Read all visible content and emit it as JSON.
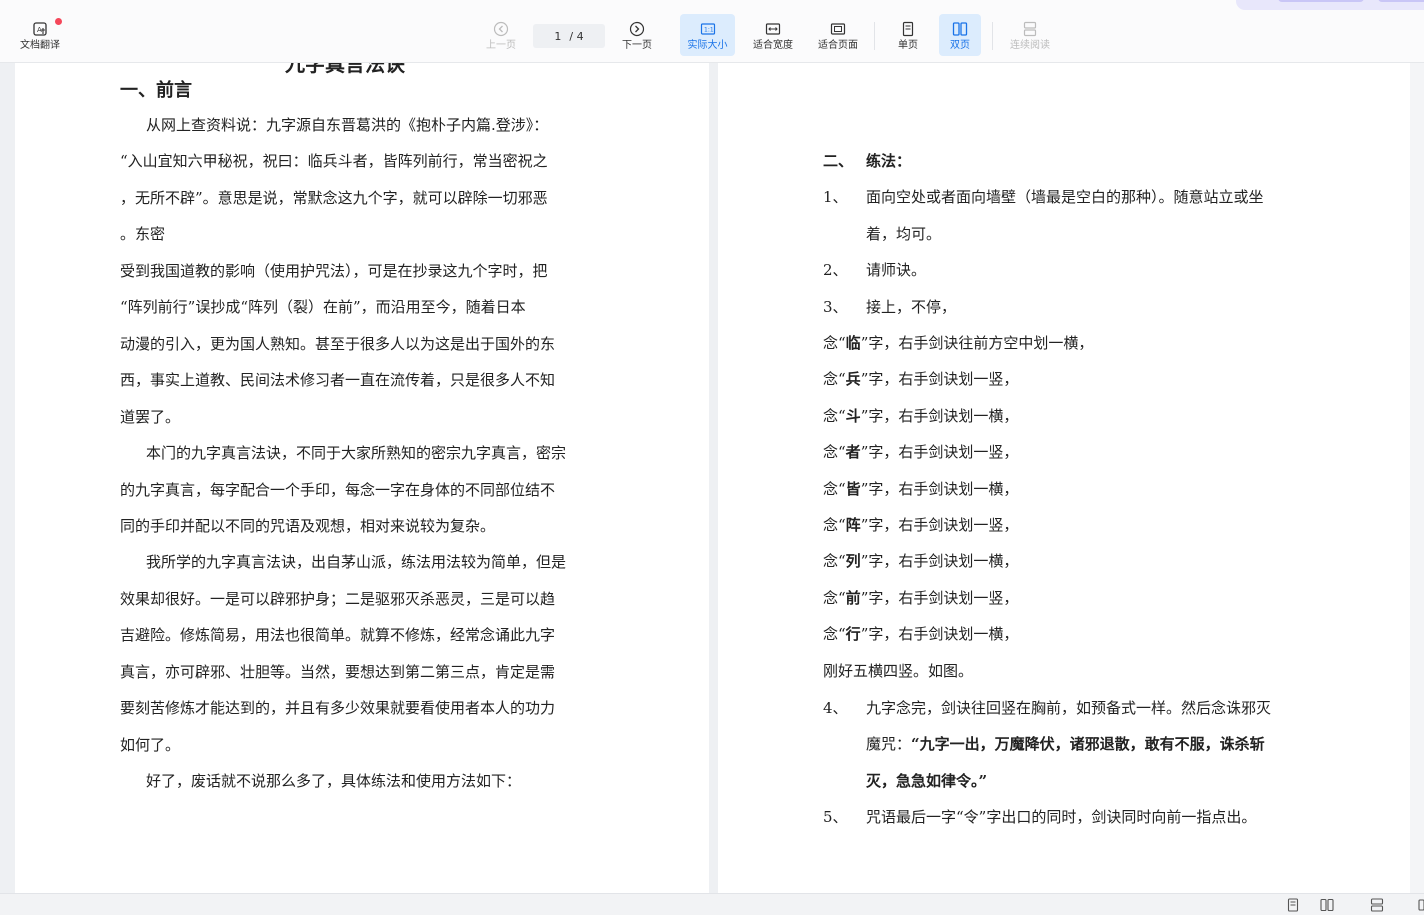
{
  "toolbar": {
    "translate_label": "文档翻译",
    "prev_label": "上一页",
    "page_current": "1",
    "page_total": "/ 4",
    "next_label": "下一页",
    "actual_size_label": "实际大小",
    "fit_width_label": "适合宽度",
    "fit_page_label": "适合页面",
    "single_page_label": "单页",
    "double_page_label": "双页",
    "continuous_label": "连续阅读"
  },
  "left_page": {
    "title_cut": "九字真言法诀",
    "heading": "一、前言",
    "lines": [
      "从网上查资料说：九字源自东晋葛洪的《抱朴子内篇.登涉》：",
      "“入山宜知六甲秘祝，祝曰：临兵斗者，皆阵列前行，常当密祝之",
      "，无所不辟”。意思是说，常默念这九个字，就可以辟除一切邪恶",
      "。东密",
      "受到我国道教的影响（使用护咒法），可是在抄录这九个字时，把",
      "“阵列前行”误抄成“阵列（裂）在前”，而沿用至今，随着日本",
      "动漫的引入，更为国人熟知。甚至于很多人以为这是出于国外的东",
      "西，事实上道教、民间法术修习者一直在流传着，只是很多人不知",
      "道罢了。",
      "本门的九字真言法诀，不同于大家所熟知的密宗九字真言，密宗",
      "的九字真言，每字配合一个手印，每念一字在身体的不同部位结不",
      "同的手印并配以不同的咒语及观想，相对来说较为复杂。",
      "我所学的九字真言法诀，出自茅山派，练法用法较为简单，但是",
      "效果却很好。一是可以辟邪护身；二是驱邪灭杀恶灵，三是可以趋",
      "吉避险。修炼简易，用法也很简单。就算不修炼，经常念诵此九字",
      "真言，亦可辟邪、壮胆等。当然，要想达到第二第三点，肯定是需",
      "要刻苦修炼才能达到的，并且有多少效果就要看使用者本人的功力",
      "如何了。",
      "好了，废话就不说那么多了，具体练法和使用方法如下："
    ]
  },
  "right_page": {
    "heading_num": "二、",
    "heading_text": "练法：",
    "item1_num": "1、",
    "item1_a": "面向空处或者面向墙壁（墙最是空白的那种）。随意站立或坐",
    "item1_b": "着，均可。",
    "item2_num": "2、",
    "item2": "请师诀。",
    "item3_num": "3、",
    "item3": "接上，不停，",
    "chants": [
      {
        "pre": "念“",
        "ch": "临",
        "post": "”字，右手剑诀往前方空中划一横，"
      },
      {
        "pre": "念“",
        "ch": "兵",
        "post": "”字，右手剑诀划一竖，"
      },
      {
        "pre": "念“",
        "ch": "斗",
        "post": "”字，右手剑诀划一横，"
      },
      {
        "pre": "念“",
        "ch": "者",
        "post": "”字，右手剑诀划一竖，"
      },
      {
        "pre": "念“",
        "ch": "皆",
        "post": "”字，右手剑诀划一横，"
      },
      {
        "pre": "念“",
        "ch": "阵",
        "post": "”字，右手剑诀划一竖，"
      },
      {
        "pre": "念“",
        "ch": "列",
        "post": "”字，右手剑诀划一横，"
      },
      {
        "pre": "念“",
        "ch": "前",
        "post": "”字，右手剑诀划一竖，"
      },
      {
        "pre": "念“",
        "ch": "行",
        "post": "”字，右手剑诀划一横，"
      }
    ],
    "summary": "刚好五横四竖。如图。",
    "item4_num": "4、",
    "item4_a": "九字念完，剑诀往回竖在胸前，如预备式一样。然后念诛邪灭",
    "item4_b_plain": "魔咒：",
    "item4_b_bold": "“九字一出，万魔降伏，诸邪退散，敢有不服，诛杀斩",
    "item4_c_bold": "灭，急急如律令。”",
    "item5_num": "5、",
    "item5": "咒语最后一字“令”字出口的同时，剑诀同时向前一指点出。"
  },
  "colors": {
    "accent": "#1a73e8",
    "active_bg": "#dcecfd",
    "notification_dot": "#f5475a"
  }
}
